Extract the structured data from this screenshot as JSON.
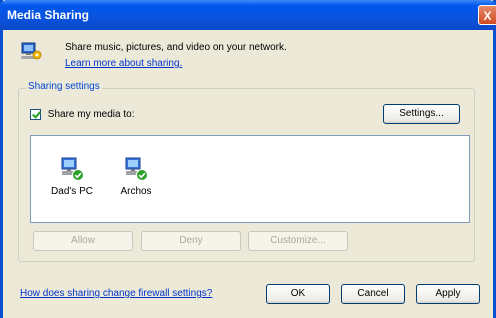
{
  "window": {
    "title": "Media Sharing",
    "close_label": "X"
  },
  "intro": {
    "text": "Share music, pictures, and video on your network.",
    "link": "Learn more about sharing."
  },
  "sharing": {
    "group_label": "Sharing settings",
    "checkbox_label": "Share my media to:",
    "checkbox_checked": true,
    "settings_button": "Settings..."
  },
  "devices": [
    {
      "label": "Dad's PC",
      "icon": "shared-computer-icon",
      "shared": true
    },
    {
      "label": "Archos",
      "icon": "shared-computer-icon",
      "shared": true
    }
  ],
  "actions": {
    "allow": "Allow",
    "deny": "Deny",
    "customize": "Customize..."
  },
  "footer": {
    "link": "How does sharing change firewall settings?",
    "ok": "OK",
    "cancel": "Cancel",
    "apply": "Apply"
  },
  "colors": {
    "titlebar": "#0a52dd",
    "link": "#0033cc",
    "group_label": "#0046d5",
    "window_bg": "#ece9d8"
  }
}
